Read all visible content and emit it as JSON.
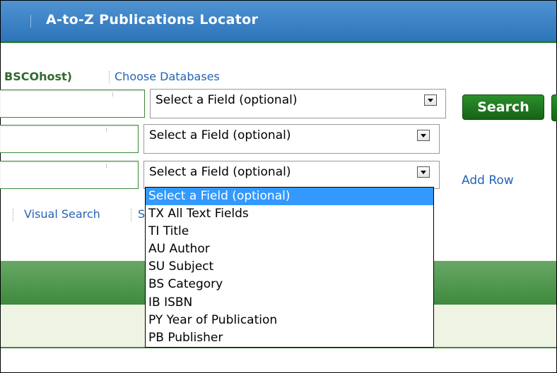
{
  "header": {
    "title": "A-to-Z Publications Locator"
  },
  "database_line": {
    "host_label": "BSCOhost)",
    "choose_link": "Choose Databases"
  },
  "search_rows": [
    {
      "field_value": "Select a Field (optional)"
    },
    {
      "field_value": "Select a Field (optional)"
    },
    {
      "field_value": "Select a Field (optional)"
    }
  ],
  "search_button": "Search",
  "add_row_link": "Add Row",
  "links": {
    "visual_search": "Visual Search",
    "partial": "S"
  },
  "dropdown_options": [
    "Select a Field (optional)",
    "TX All Text Fields",
    "TI Title",
    "AU Author",
    "SU Subject",
    "BS Category",
    "IB ISBN",
    "PY Year of Publication",
    "PB Publisher"
  ],
  "dropdown_selected_index": 0,
  "colors": {
    "header_blue": "#3a80c4",
    "green": "#2f7a3a",
    "highlight": "#3399ff",
    "link": "#2563b6"
  }
}
